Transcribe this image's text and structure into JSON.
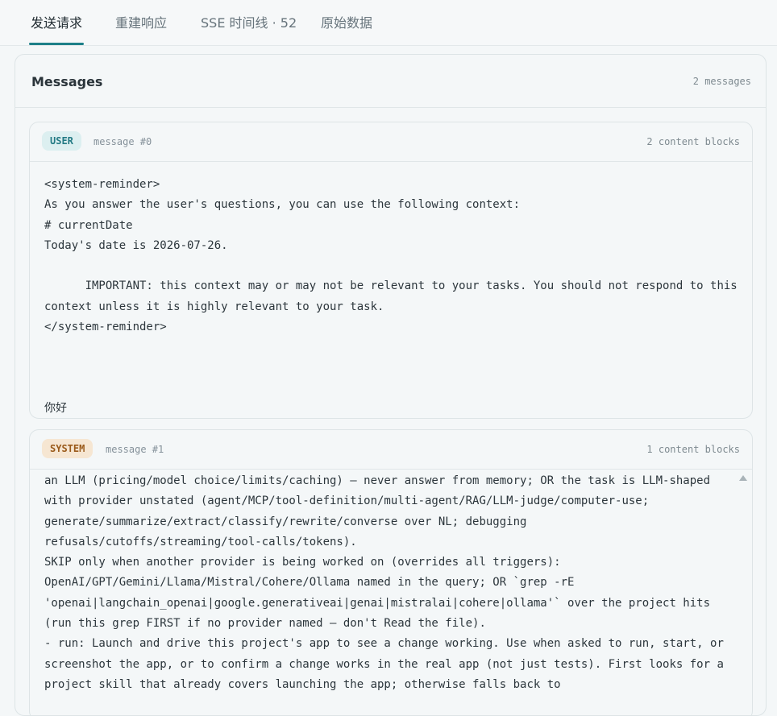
{
  "tabs": [
    {
      "label": "发送请求",
      "active": true
    },
    {
      "label": "重建响应"
    },
    {
      "label": "SSE 时间线 · 52"
    },
    {
      "label": "原始数据"
    }
  ],
  "messages_panel": {
    "title": "Messages",
    "count": "2 messages"
  },
  "messages": [
    {
      "role": "USER",
      "index_label": "message #0",
      "blocks_label": "2 content blocks",
      "content": "<system-reminder>\nAs you answer the user's questions, you can use the following context:\n# currentDate\nToday's date is 2026-07-26.\n\n      IMPORTANT: this context may or may not be relevant to your tasks. You should not respond to this context unless it is highly relevant to your task.\n</system-reminder>\n\n\n\n你好"
    },
    {
      "role": "SYSTEM",
      "index_label": "message #1",
      "blocks_label": "1 content blocks",
      "content": "an LLM (pricing/model choice/limits/caching) — never answer from memory; OR the task is LLM-shaped with provider unstated (agent/MCP/tool-definition/multi-agent/RAG/LLM-judge/computer-use; generate/summarize/extract/classify/rewrite/converse over NL; debugging refusals/cutoffs/streaming/tool-calls/tokens).\nSKIP only when another provider is being worked on (overrides all triggers): OpenAI/GPT/Gemini/Llama/Mistral/Cohere/Ollama named in the query; OR `grep -rE 'openai|langchain_openai|google.generativeai|genai|mistralai|cohere|ollama'` over the project hits (run this grep FIRST if no provider named — don't Read the file).\n- run: Launch and drive this project's app to see a change working. Use when asked to run, start, or screenshot the app, or to confirm a change works in the real app (not just tests). First looks for a project skill that already covers launching the app; otherwise falls back to"
    }
  ],
  "colors": {
    "accent": "#1d7f88",
    "user_badge_bg": "#dceff0",
    "system_badge_bg": "#f6e6d2"
  }
}
